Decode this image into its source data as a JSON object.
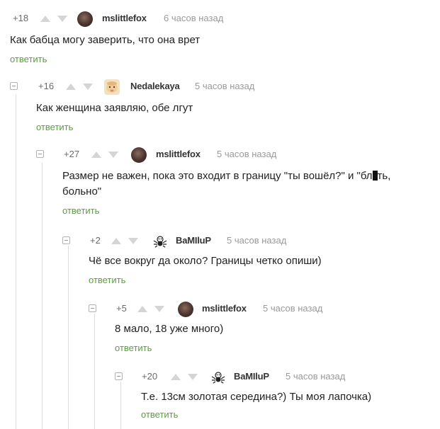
{
  "reply_label": "ответить",
  "comments": [
    {
      "rating": "+18",
      "author": "mslittlefox",
      "time": "6 часов назад",
      "text": "Как бабца могу заверить, что она врет",
      "avatar": "avatar-dark-photo"
    },
    {
      "rating": "+16",
      "author": "Nedalekaya",
      "time": "5 часов назад",
      "text": "Как женщина заявляю, обе лгут",
      "avatar": "avatar-baby-photo"
    },
    {
      "rating": "+27",
      "author": "mslittlefox",
      "time": "5 часов назад",
      "text_before": "Размер не важен, пока это входит в границу \"ты вошёл?\" и \"бл",
      "text_after": "ть,",
      "text_line2": "больно\"",
      "avatar": "avatar-dark-photo"
    },
    {
      "rating": "+2",
      "author": "BaMIluP",
      "time": "5 часов назад",
      "text": "Чё все вокруг да около? Границы четко опиши)",
      "avatar": "avatar-spider-icon"
    },
    {
      "rating": "+5",
      "author": "mslittlefox",
      "time": "5 часов назад",
      "text": "8 мало, 18 уже много)",
      "avatar": "avatar-dark-photo"
    },
    {
      "rating": "+20",
      "author": "BaMIluP",
      "time": "5 часов назад",
      "text": "Т.е. 13см золотая середина?) Ты моя лапочка)",
      "avatar": "avatar-spider-icon"
    }
  ],
  "colors": {
    "reply": "#5a9e3e",
    "time": "#9a9a9a",
    "vote": "#d5d5d5",
    "branch": "#dddddd"
  }
}
